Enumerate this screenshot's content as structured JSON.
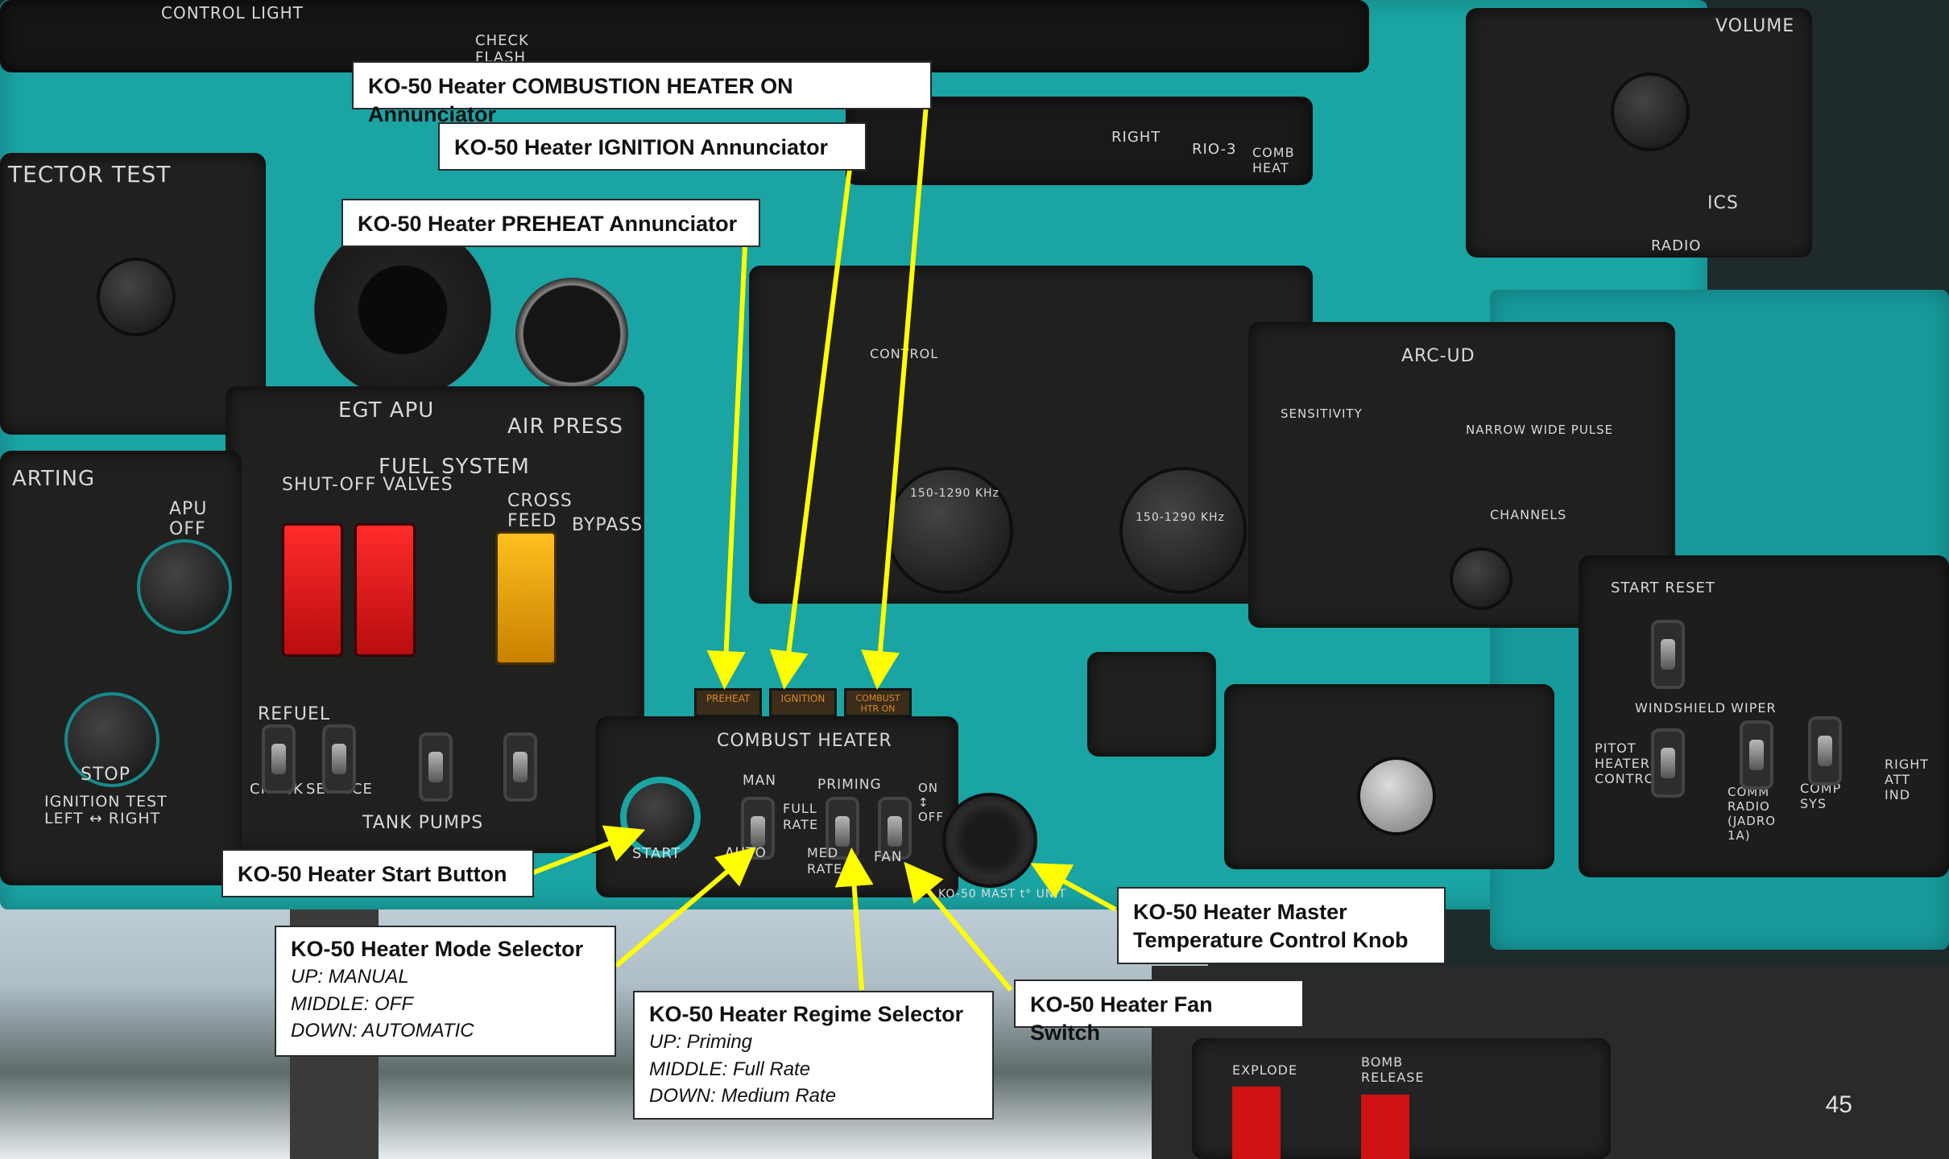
{
  "callouts": {
    "combustion_heater_on": "KO-50 Heater COMBUSTION HEATER ON Annunciator",
    "ignition": "KO-50 Heater IGNITION Annunciator",
    "preheat": "KO-50 Heater PREHEAT Annunciator",
    "start_button": "KO-50 Heater Start Button",
    "mode_selector": {
      "title": "KO-50 Heater Mode Selector",
      "lines": [
        "UP: MANUAL",
        "MIDDLE: OFF",
        "DOWN: AUTOMATIC"
      ]
    },
    "regime_selector": {
      "title": "KO-50 Heater Regime Selector",
      "lines": [
        "UP: Priming",
        "MIDDLE: Full Rate",
        "DOWN: Medium Rate"
      ]
    },
    "fan_switch": "KO-50 Heater Fan Switch",
    "master_temp_knob": {
      "line1": "KO-50 Heater Master",
      "line2": "Temperature Control Knob"
    }
  },
  "panel_labels": {
    "combust_heater": "COMBUST HEATER",
    "man": "MAN",
    "auto": "AUTO",
    "priming": "PRIMING",
    "full_rate": "FULL RATE",
    "med_rate": "MED RATE",
    "start": "START",
    "on_off": "ON ↕ OFF",
    "fan": "FAN",
    "ko50_mast": "KO-50 MAST t° UNIT",
    "ann_preheat": "PREHEAT",
    "ann_ignition": "IGNITION",
    "ann_combust": "COMBUST HTR ON",
    "fuel_system": "FUEL SYSTEM",
    "egt_apu": "EGT APU",
    "air_press": "AIR PRESS",
    "shutoff_valves": "SHUT-OFF VALVES",
    "left": "LEFT",
    "right": "RIGHT",
    "cross_feed": "CROSS FEED",
    "bypass": "BYPASS",
    "refuel": "REFUEL",
    "check": "CHECK",
    "service": "SERVICE",
    "tank_pumps": "TANK PUMPS",
    "detector_test": "TECTOR TEST",
    "starting": "ARTING",
    "apu_off": "APU OFF",
    "stop": "STOP",
    "ignition_test": "IGNITION TEST",
    "left_right": "LEFT ↔ RIGHT",
    "arc_ud": "ARC-UD",
    "sensitivity": "SENSITIVITY",
    "narrow_wide_pulse": "NARROW WIDE PULSE",
    "channels": "CHANNELS",
    "control": "CONTROL",
    "freq1": "150-1290 KHz",
    "freq2": "150-1290 KHz",
    "windshield_wiper": "WINDSHIELD WIPER",
    "start_reset": "START RESET",
    "pitot_heater": "PITOT HEATER CONTROL",
    "comm_radio": "COMM RADIO (JADRO 1A)",
    "comp_sys": "COMP SYS",
    "right_att_ind": "RIGHT ATT IND",
    "ics": "ICS",
    "radio": "RADIO",
    "volume": "VOLUME",
    "comb_heat": "COMB HEAT",
    "right_top": "RIGHT",
    "rio3": "RIO-3",
    "check_flash": "CHECK FLASH",
    "control_light": "CONTROL LIGHT",
    "explode": "EXPLODE",
    "bomb_release": "BOMB RELEASE"
  },
  "page_number": "45",
  "colors": {
    "panel": "#1aa4a4",
    "arrow": "#ffff00",
    "annunciator": "#d88a2a"
  }
}
